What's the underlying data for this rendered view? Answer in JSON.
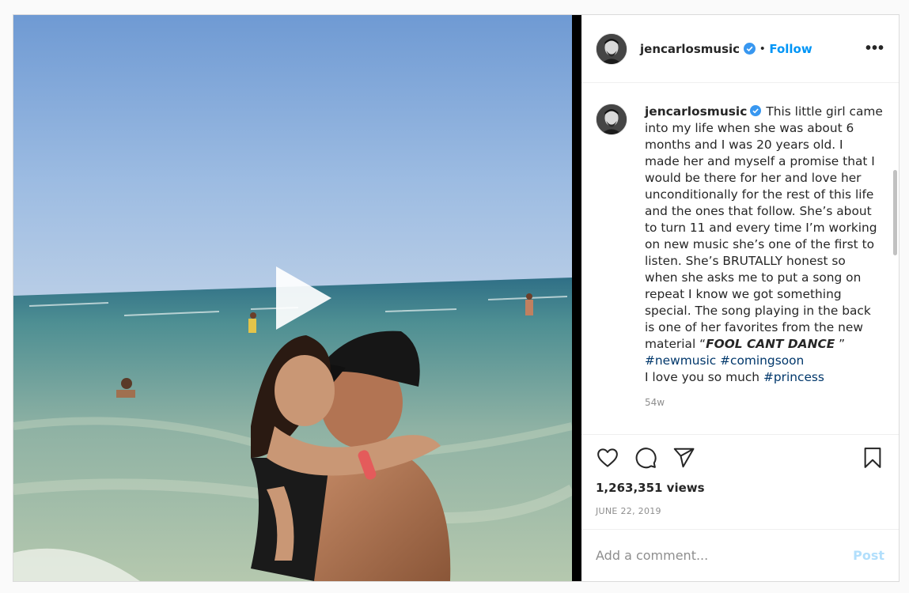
{
  "header": {
    "username": "jencarlosmusic",
    "dot": "•",
    "follow_label": "Follow",
    "more_label": "•••"
  },
  "caption": {
    "username": "jencarlosmusic",
    "lines": [
      "This little girl came",
      "into my life when she was about 6",
      "months and I was 20 years old. I",
      "made her and myself a promise that I",
      "would be there for her and love her",
      "unconditionally for the rest of this life",
      "and the ones that follow. She’s about",
      "to turn 11 and every time I’m working",
      "on new music she’s one of the first to",
      "listen. She’s BRUTALLY honest so",
      "when she asks me to put a song on",
      "repeat I know we got something",
      "special. The song playing in the back",
      "is one of her favorites from the new"
    ],
    "material_prefix": "material “",
    "song_title": "FOOL CANT DANCE",
    "material_suffix": " ”",
    "hashtags_line": [
      "#newmusic",
      "#comingsoon"
    ],
    "love_text": "I love you so much ",
    "love_tag": "#princess",
    "time_ago": "54w"
  },
  "stats": {
    "views": "1,263,351 views",
    "date": "JUNE 22, 2019"
  },
  "comment_box": {
    "placeholder": "Add a comment...",
    "post_label": "Post"
  },
  "icons": {
    "like": "heart-icon",
    "comment": "comment-icon",
    "share": "share-icon",
    "save": "bookmark-icon",
    "verified": "verified-badge-icon",
    "play": "play-icon"
  },
  "colors": {
    "link": "#0095f6",
    "hashtag": "#00376b",
    "muted": "#8e8e8e",
    "post_disabled": "#b2dffc"
  }
}
